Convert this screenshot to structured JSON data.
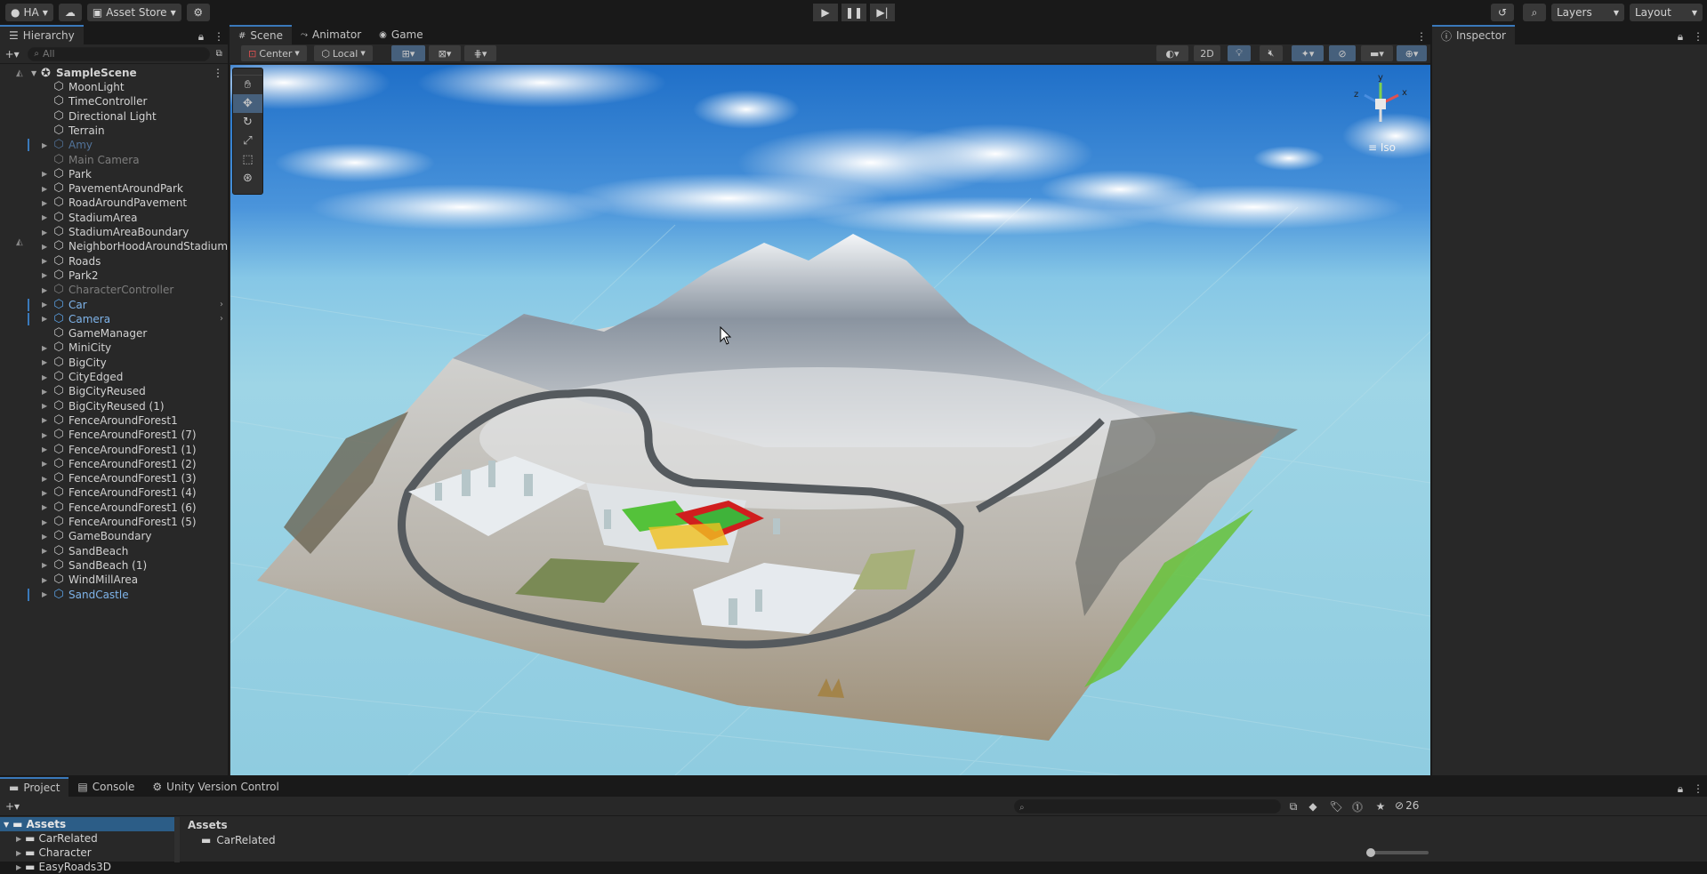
{
  "toolbar": {
    "account_label": "HA",
    "asset_store_label": "Asset Store",
    "layers_label": "Layers",
    "layout_label": "Layout"
  },
  "hierarchy": {
    "tab_label": "Hierarchy",
    "search_placeholder": "All",
    "scene_name": "SampleScene",
    "items": [
      {
        "label": "MoonLight",
        "state": "normal",
        "expandable": false
      },
      {
        "label": "TimeController",
        "state": "normal",
        "expandable": false
      },
      {
        "label": "Directional Light",
        "state": "normal",
        "expandable": false
      },
      {
        "label": "Terrain",
        "state": "normal",
        "expandable": false
      },
      {
        "label": "Amy",
        "state": "prefab-dim",
        "expandable": true
      },
      {
        "label": "Main Camera",
        "state": "dim",
        "expandable": false
      },
      {
        "label": "Park",
        "state": "normal",
        "expandable": true
      },
      {
        "label": "PavementAroundPark",
        "state": "normal",
        "expandable": true
      },
      {
        "label": "RoadAroundPavement",
        "state": "normal",
        "expandable": true
      },
      {
        "label": "StadiumArea",
        "state": "normal",
        "expandable": true
      },
      {
        "label": "StadiumAreaBoundary",
        "state": "normal",
        "expandable": true
      },
      {
        "label": "NeighborHoodAroundStadium",
        "state": "normal",
        "expandable": true
      },
      {
        "label": "Roads",
        "state": "normal",
        "expandable": true
      },
      {
        "label": "Park2",
        "state": "normal",
        "expandable": true
      },
      {
        "label": "CharacterController",
        "state": "dim",
        "expandable": true
      },
      {
        "label": "Car",
        "state": "prefab",
        "expandable": true
      },
      {
        "label": "Camera",
        "state": "prefab",
        "expandable": true
      },
      {
        "label": "GameManager",
        "state": "normal",
        "expandable": false
      },
      {
        "label": "MiniCity",
        "state": "normal",
        "expandable": true
      },
      {
        "label": "BigCity",
        "state": "normal",
        "expandable": true
      },
      {
        "label": "CityEdged",
        "state": "normal",
        "expandable": true
      },
      {
        "label": "BigCityReused",
        "state": "normal",
        "expandable": true
      },
      {
        "label": "BigCityReused (1)",
        "state": "normal",
        "expandable": true
      },
      {
        "label": "FenceAroundForest1",
        "state": "normal",
        "expandable": true
      },
      {
        "label": "FenceAroundForest1 (7)",
        "state": "normal",
        "expandable": true
      },
      {
        "label": "FenceAroundForest1 (1)",
        "state": "normal",
        "expandable": true
      },
      {
        "label": "FenceAroundForest1 (2)",
        "state": "normal",
        "expandable": true
      },
      {
        "label": "FenceAroundForest1 (3)",
        "state": "normal",
        "expandable": true
      },
      {
        "label": "FenceAroundForest1 (4)",
        "state": "normal",
        "expandable": true
      },
      {
        "label": "FenceAroundForest1 (6)",
        "state": "normal",
        "expandable": true
      },
      {
        "label": "FenceAroundForest1 (5)",
        "state": "normal",
        "expandable": true
      },
      {
        "label": "GameBoundary",
        "state": "normal",
        "expandable": true
      },
      {
        "label": "SandBeach",
        "state": "normal",
        "expandable": true
      },
      {
        "label": "SandBeach (1)",
        "state": "normal",
        "expandable": true
      },
      {
        "label": "WindMillArea",
        "state": "normal",
        "expandable": true
      },
      {
        "label": "SandCastle",
        "state": "prefab",
        "expandable": true
      }
    ]
  },
  "scene": {
    "tabs": [
      "Scene",
      "Animator",
      "Game"
    ],
    "pivot_label": "Center",
    "space_label": "Local",
    "mode_2d_label": "2D",
    "gizmo_view_label": "Iso",
    "gizmo_axes": [
      "y",
      "x",
      "z"
    ]
  },
  "inspector": {
    "tab_label": "Inspector"
  },
  "project": {
    "tabs": [
      "Project",
      "Console",
      "Unity Version Control"
    ],
    "tree_root": "Assets",
    "tree_items": [
      "CarRelated",
      "Character",
      "EasyRoads3D"
    ],
    "breadcrumb": "Assets",
    "folder_items": [
      "CarRelated"
    ],
    "hidden_count": "26"
  }
}
